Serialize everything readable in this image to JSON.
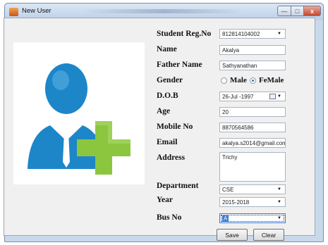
{
  "window": {
    "title": "New User"
  },
  "window_buttons": {
    "minimize": "—",
    "maximize": "□",
    "close": "x"
  },
  "form": {
    "student_reg_no": {
      "label": "Student Reg.No",
      "value": "812814104002"
    },
    "name": {
      "label": "Name",
      "value": "Akalya"
    },
    "father_name": {
      "label": "Father Name",
      "value": "Sathyanathan"
    },
    "gender": {
      "label": "Gender",
      "options": [
        "Male",
        "FeMale"
      ],
      "selected": "FeMale"
    },
    "dob": {
      "label": "D.O.B",
      "value": "26-Jul -1997"
    },
    "age": {
      "label": "Age",
      "value": "20"
    },
    "mobile_no": {
      "label": "Mobile No",
      "value": "8870564586"
    },
    "email": {
      "label": "Email",
      "value": "akalya.s2014@gmail.com"
    },
    "address": {
      "label": "Address",
      "value": "Trichy"
    },
    "department": {
      "label": "Department",
      "value": "CSE"
    },
    "year": {
      "label": "Year",
      "value": "2015-2018"
    },
    "bus_no": {
      "label": "Bus No",
      "value": "A"
    }
  },
  "buttons": {
    "save": "Save",
    "clear": "Clear"
  },
  "colors": {
    "person_blue": "#1d86c8",
    "plus_green": "#8cc63f",
    "selection_blue": "#3a7bd5"
  },
  "icons": {
    "app": "form-icon",
    "illustration": "add-user-icon",
    "date_picker": "calendar-icon"
  }
}
